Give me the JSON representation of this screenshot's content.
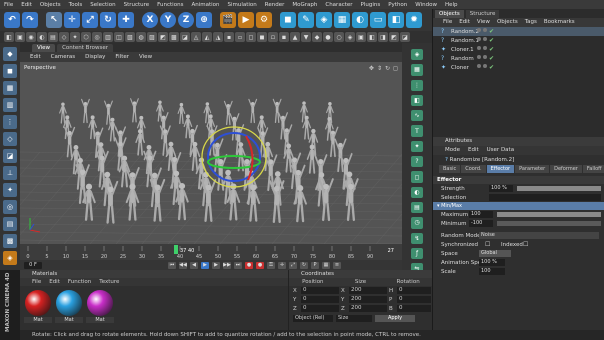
{
  "menubar": {
    "items": [
      "File",
      "Edit",
      "Objects",
      "Tools",
      "Selection",
      "Structure",
      "Functions",
      "Animation",
      "Simulation",
      "Render",
      "MoGraph",
      "Character",
      "Plugins",
      "Python",
      "Window",
      "Help"
    ]
  },
  "toolbar": {
    "axis_x": "X",
    "axis_y": "Y",
    "axis_z": "Z"
  },
  "viewport": {
    "tabs": [
      "View",
      "Content Browser"
    ],
    "menu": [
      "Edit",
      "Cameras",
      "Display",
      "Filter",
      "View"
    ],
    "label": "Perspective",
    "background_color": "#545454"
  },
  "timeline": {
    "ticks": [
      "0",
      "5",
      "10",
      "15",
      "20",
      "25",
      "30",
      "35",
      "40",
      "45",
      "50",
      "55",
      "60",
      "65",
      "70",
      "75",
      "80",
      "85",
      "90"
    ],
    "current_frame_label": "37",
    "current_frame_suffix": "40",
    "end_label": "90",
    "end_right": "27",
    "frame_start": "0 F",
    "frame_end": "90"
  },
  "materials": {
    "title": "Materials",
    "menu": [
      "File",
      "Edit",
      "Function",
      "Texture"
    ],
    "items": [
      {
        "label": "Mat",
        "color": "#d62222"
      },
      {
        "label": "Mat",
        "color": "#2aa0e0"
      },
      {
        "label": "Mat",
        "color": "#c82ec8"
      }
    ]
  },
  "coordinates": {
    "title": "Coordinates",
    "headers": [
      "Position",
      "Size",
      "Rotation"
    ],
    "rows": [
      {
        "a": "X",
        "av": "0",
        "b": "X",
        "bv": "200",
        "c": "H",
        "cv": "0"
      },
      {
        "a": "Y",
        "av": "0",
        "b": "Y",
        "bv": "200",
        "c": "P",
        "cv": "0"
      },
      {
        "a": "Z",
        "av": "0",
        "b": "Z",
        "bv": "200",
        "c": "B",
        "cv": "0"
      }
    ],
    "mode": "Object (Rel)",
    "size_mode": "Size",
    "apply": "Apply"
  },
  "objects": {
    "tabs": [
      "Objects",
      "Structure"
    ],
    "menu": [
      "File",
      "Edit",
      "View",
      "Objects",
      "Tags",
      "Bookmarks"
    ],
    "list": [
      {
        "name": "Random.2",
        "selected": true
      },
      {
        "name": "Random.1",
        "selected": false
      },
      {
        "name": "Cloner.1",
        "selected": false
      },
      {
        "name": "Random",
        "selected": false
      },
      {
        "name": "Cloner",
        "selected": false
      }
    ]
  },
  "attributes": {
    "title": "Attributes",
    "menu": [
      "Mode",
      "Edit",
      "User Data"
    ],
    "object_title": "Randomize [Random.2]",
    "tabs": [
      "Basic",
      "Coord.",
      "Effector",
      "Parameter",
      "Deformer",
      "Falloff"
    ],
    "active_tab": "Effector",
    "section": "Effector",
    "strength_label": "Strength",
    "strength_value": "100 %",
    "selection_label": "Selection",
    "minmax_label": "Min/Max",
    "maximum_label": "Maximum",
    "maximum_value": "100",
    "minimum_label": "Minimum",
    "minimum_value": "-100",
    "random_mode_label": "Random Mode",
    "random_mode_value": "Noise",
    "synchronized_label": "Synchronized",
    "indexed_label": "Indexed",
    "space_label": "Space",
    "space_value": "Global",
    "anim_speed_label": "Animation Speed",
    "anim_speed_value": "100 %",
    "scale_label": "Scale",
    "scale_value": "100"
  },
  "status": {
    "text": "Rotate: Click and drag to rotate elements. Hold down SHIFT to add to quantize rotation / add to the selection in point mode, CTRL to remove."
  },
  "logo": {
    "text": "MAXON CINEMA 4D"
  }
}
